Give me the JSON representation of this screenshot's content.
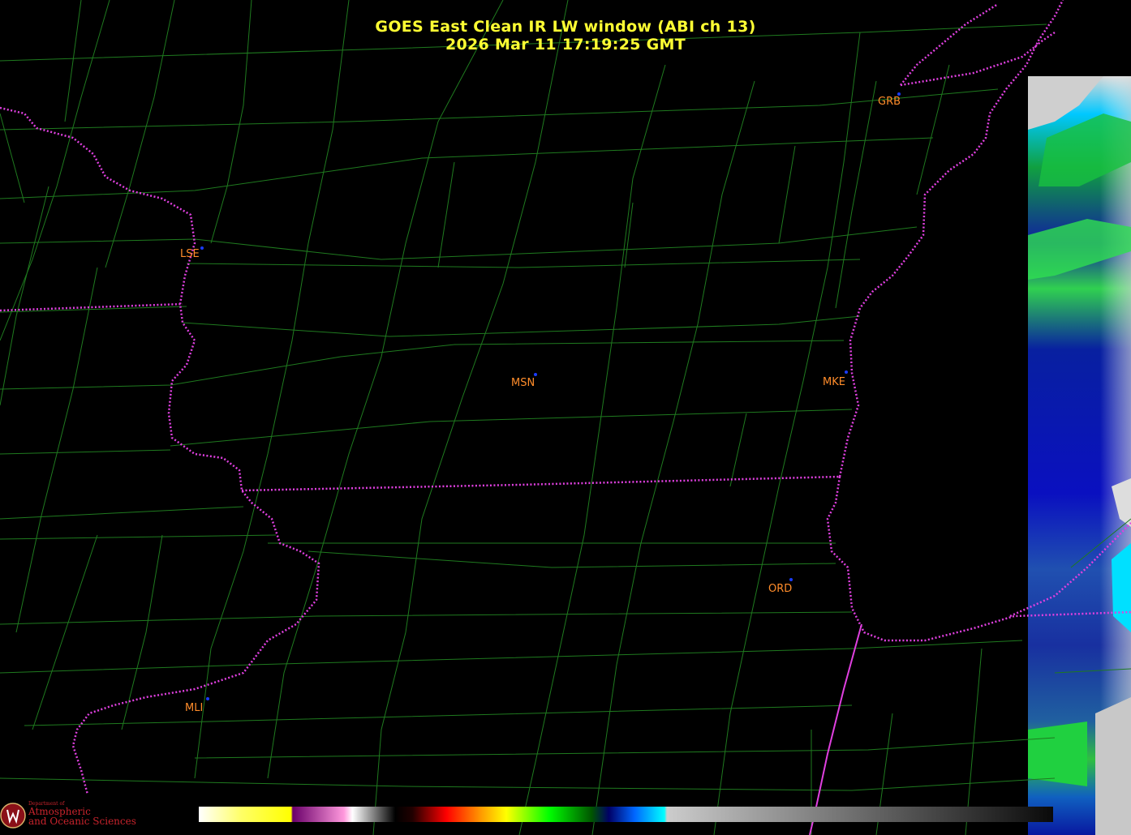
{
  "title": {
    "line1": "GOES East Clean IR LW window (ABI ch 13)",
    "line2": "2026 Mar 11  17:19:25 GMT"
  },
  "stations": [
    {
      "code": "GRB"
    },
    {
      "code": "LSE"
    },
    {
      "code": "MSN"
    },
    {
      "code": "MKE"
    },
    {
      "code": "ORD"
    },
    {
      "code": "MLI"
    }
  ],
  "logo": {
    "line_small": "Department of",
    "line1": "Atmospheric",
    "line2": "and Oceanic Sciences",
    "emblem": "W"
  },
  "colors": {
    "background": "#000000",
    "county_lines": "#1f7a1f",
    "state_borders": "#e040e0",
    "title": "#ffff33",
    "station_label": "#ff8c2a",
    "station_dot": "#1a3cff"
  },
  "colorbar": {
    "stops": [
      "#ffffff",
      "#ffff33",
      "#8b008b",
      "#ff88cc",
      "#ffffff",
      "#000000",
      "#ff0000",
      "#ff8800",
      "#ffff00",
      "#00ff00",
      "#006600",
      "#000066",
      "#00ccff",
      "#cccccc",
      "#000000"
    ]
  },
  "icons": [
    "university-seal-icon"
  ]
}
